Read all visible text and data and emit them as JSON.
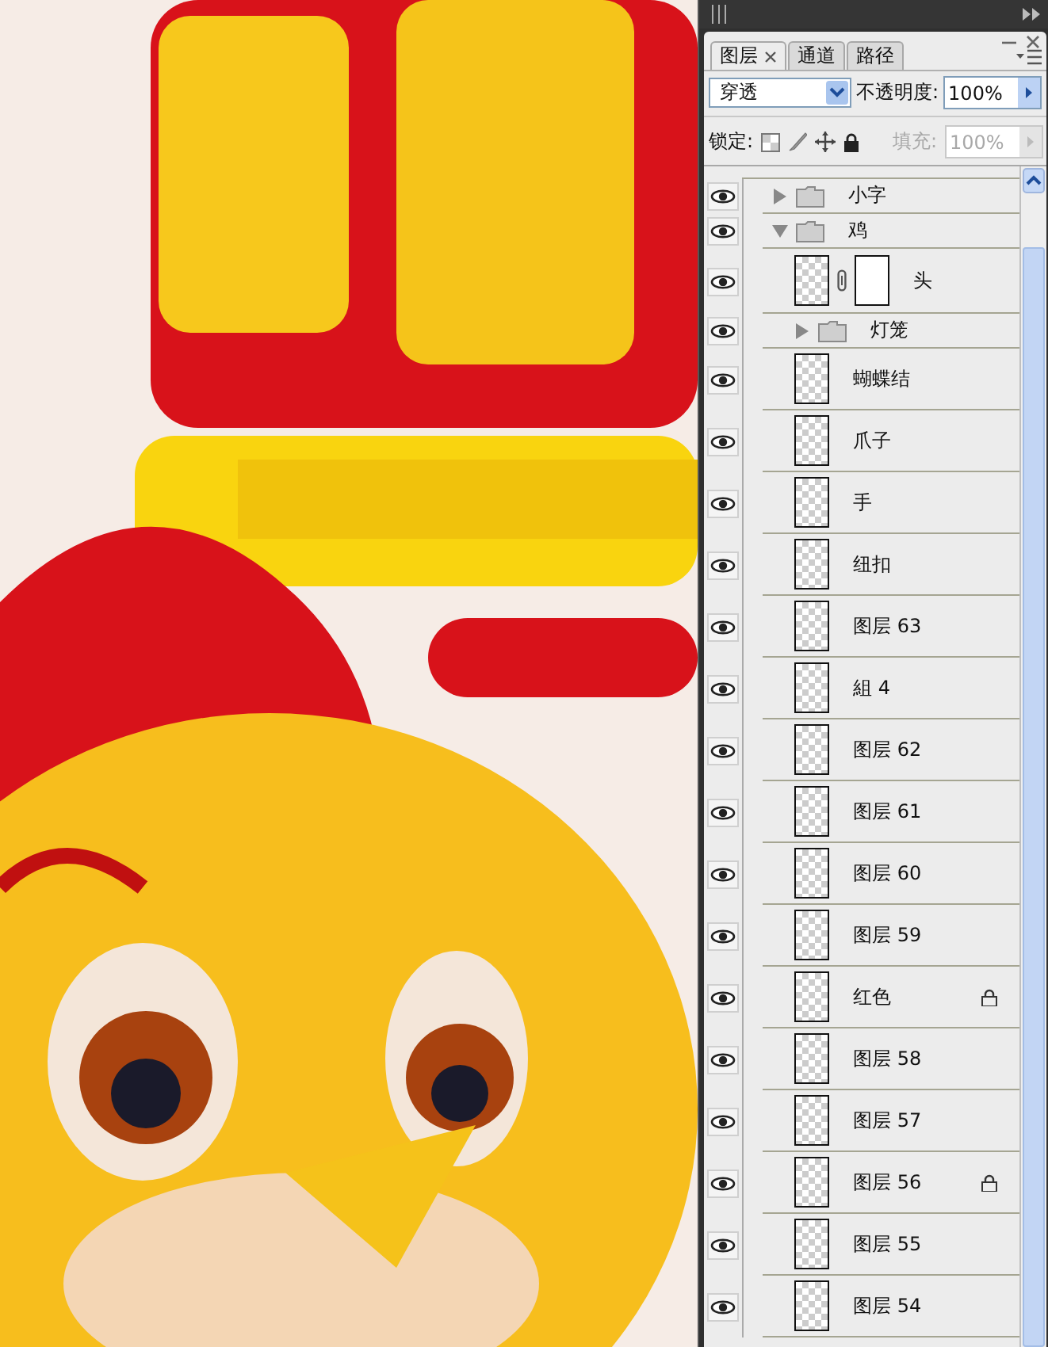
{
  "panel": {
    "tabs": [
      {
        "label": "图层",
        "selected": true,
        "closable": true
      },
      {
        "label": "通道",
        "selected": false,
        "closable": false
      },
      {
        "label": "路径",
        "selected": false,
        "closable": false
      }
    ],
    "blend_mode": {
      "value": "穿透"
    },
    "opacity": {
      "label": "不透明度:",
      "value": "100%"
    },
    "lock": {
      "label": "锁定:"
    },
    "fill": {
      "label": "填充:",
      "value": "100%",
      "disabled": true
    },
    "layers": [
      {
        "kind": "folder",
        "name": "小字",
        "visible": true,
        "expanded": false
      },
      {
        "kind": "folder",
        "name": "鸡",
        "visible": true,
        "expanded": true,
        "children": [
          {
            "kind": "masked_layer",
            "name": "头",
            "visible": true,
            "locked": false
          },
          {
            "kind": "folder",
            "name": "灯笼",
            "visible": true,
            "expanded": false
          },
          {
            "kind": "layer",
            "name": "蝴蝶结",
            "visible": true,
            "locked": false
          },
          {
            "kind": "layer",
            "name": "爪子",
            "visible": true,
            "locked": false
          },
          {
            "kind": "layer",
            "name": "手",
            "visible": true,
            "locked": false
          },
          {
            "kind": "layer",
            "name": "纽扣",
            "visible": true,
            "locked": false
          },
          {
            "kind": "layer",
            "name": "图层 63",
            "visible": true,
            "locked": false
          },
          {
            "kind": "layer",
            "name": "組 4",
            "visible": true,
            "locked": false
          },
          {
            "kind": "layer",
            "name": "图层 62",
            "visible": true,
            "locked": false
          },
          {
            "kind": "layer",
            "name": "图层 61",
            "visible": true,
            "locked": false
          },
          {
            "kind": "layer",
            "name": "图层 60",
            "visible": true,
            "locked": false
          },
          {
            "kind": "layer",
            "name": "图层 59",
            "visible": true,
            "locked": false
          },
          {
            "kind": "layer",
            "name": "红色",
            "visible": true,
            "locked": true
          },
          {
            "kind": "layer",
            "name": "图层 58",
            "visible": true,
            "locked": false
          },
          {
            "kind": "layer",
            "name": "图层 57",
            "visible": true,
            "locked": false
          },
          {
            "kind": "layer",
            "name": "图层 56",
            "visible": true,
            "locked": true
          },
          {
            "kind": "layer",
            "name": "图层 55",
            "visible": true,
            "locked": false
          },
          {
            "kind": "layer",
            "name": "图层 54",
            "visible": true,
            "locked": false
          }
        ]
      }
    ]
  }
}
